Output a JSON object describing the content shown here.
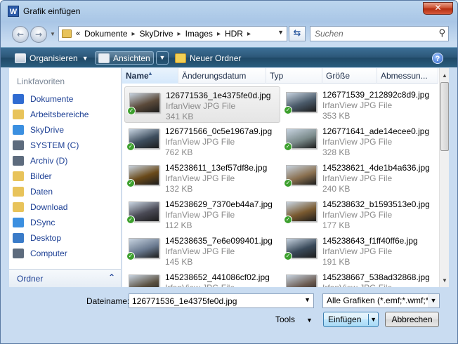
{
  "window": {
    "title": "Grafik einfügen",
    "app_icon": "W"
  },
  "address": {
    "prefix": "«",
    "crumbs": [
      "Dokumente",
      "SkyDrive",
      "Images",
      "HDR"
    ],
    "search_placeholder": "Suchen"
  },
  "toolbar": {
    "organize": "Organisieren",
    "views": "Ansichten",
    "new_folder": "Neuer Ordner"
  },
  "sidebar": {
    "heading": "Linkfavoriten",
    "items": [
      {
        "label": "Dokumente",
        "icon": "documents-icon",
        "color": "#2f6bd1"
      },
      {
        "label": "Arbeitsbereiche",
        "icon": "folder-icon",
        "color": "#e8c35a"
      },
      {
        "label": "SkyDrive",
        "icon": "skydrive-icon",
        "color": "#3b8fe0"
      },
      {
        "label": "SYSTEM (C)",
        "icon": "drive-icon",
        "color": "#5d6b7d"
      },
      {
        "label": "Archiv (D)",
        "icon": "drive-icon",
        "color": "#5d6b7d"
      },
      {
        "label": "Bilder",
        "icon": "folder-icon",
        "color": "#e8c35a"
      },
      {
        "label": "Daten",
        "icon": "folder-icon",
        "color": "#e8c35a"
      },
      {
        "label": "Download",
        "icon": "folder-icon",
        "color": "#e8c35a"
      },
      {
        "label": "DSync",
        "icon": "sync-icon",
        "color": "#3b8fe0"
      },
      {
        "label": "Desktop",
        "icon": "desktop-icon",
        "color": "#3a7bc8"
      },
      {
        "label": "Computer",
        "icon": "computer-icon",
        "color": "#5d6b7d"
      }
    ],
    "folders_label": "Ordner"
  },
  "columns": [
    "Name",
    "Änderungsdatum",
    "Typ",
    "Größe",
    "Abmessun..."
  ],
  "files": [
    {
      "name": "126771536_1e4375fe0d.jpg",
      "type": "IrfanView JPG File",
      "size": "341 KB",
      "selected": true,
      "thumb": "#5b4a3a"
    },
    {
      "name": "126771539_212892c8d9.jpg",
      "type": "IrfanView JPG File",
      "size": "353 KB",
      "selected": false,
      "thumb": "#4b5b6a"
    },
    {
      "name": "126771566_0c5e1967a9.jpg",
      "type": "IrfanView JPG File",
      "size": "762 KB",
      "selected": false,
      "thumb": "#3e4e5e"
    },
    {
      "name": "126771641_ade14ecee0.jpg",
      "type": "IrfanView JPG File",
      "size": "328 KB",
      "selected": false,
      "thumb": "#7a8a8a"
    },
    {
      "name": "145238611_13ef57df8e.jpg",
      "type": "IrfanView JPG File",
      "size": "132 KB",
      "selected": false,
      "thumb": "#6a4a1a"
    },
    {
      "name": "145238621_4de1b4a636.jpg",
      "type": "IrfanView JPG File",
      "size": "240 KB",
      "selected": false,
      "thumb": "#8a7050"
    },
    {
      "name": "145238629_7370eb44a7.jpg",
      "type": "IrfanView JPG File",
      "size": "112 KB",
      "selected": false,
      "thumb": "#4a4a55"
    },
    {
      "name": "145238632_b1593513e0.jpg",
      "type": "IrfanView JPG File",
      "size": "177 KB",
      "selected": false,
      "thumb": "#7a5a30"
    },
    {
      "name": "145238635_7e6e099401.jpg",
      "type": "IrfanView JPG File",
      "size": "145 KB",
      "selected": false,
      "thumb": "#6a7a90"
    },
    {
      "name": "145238643_f1ff40ff6e.jpg",
      "type": "IrfanView JPG File",
      "size": "191 KB",
      "selected": false,
      "thumb": "#3a4a5a"
    },
    {
      "name": "145238652_441086cf02.jpg",
      "type": "IrfanView JPG File",
      "size": "",
      "selected": false,
      "thumb": "#5a5040"
    },
    {
      "name": "145238667_538ad32868.jpg",
      "type": "IrfanView JPG File",
      "size": "",
      "selected": false,
      "thumb": "#6a5a50"
    }
  ],
  "footer": {
    "filename_label": "Dateiname:",
    "filename_value": "126771536_1e4375fe0d.jpg",
    "filter": "Alle Grafiken (*.emf;*.wmf;*.jpg",
    "tools": "Tools",
    "insert": "Einfügen",
    "cancel": "Abbrechen"
  }
}
